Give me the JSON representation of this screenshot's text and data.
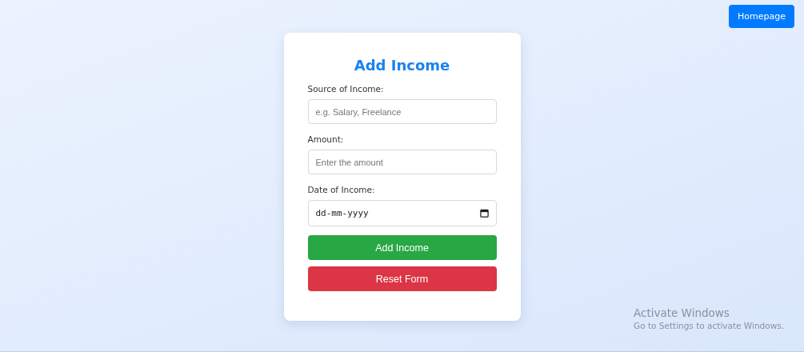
{
  "nav_button": {
    "label": "Homepage"
  },
  "form": {
    "title": "Add Income",
    "fields": [
      {
        "kind": "text",
        "label": "Source of Income:",
        "placeholder": "e.g. Salary, Freelance"
      },
      {
        "kind": "text",
        "label": "Amount:",
        "placeholder": "Enter the amount"
      },
      {
        "kind": "date",
        "label": "Date of Income:",
        "placeholder": "dd-mm-yyyy"
      }
    ],
    "buttons": [
      {
        "kind": "submit",
        "label": "Add Income"
      },
      {
        "kind": "reset",
        "label": "Reset Form"
      }
    ]
  },
  "os_notice": {
    "title": "Activate Windows",
    "message": "Go to Settings to activate Windows."
  }
}
